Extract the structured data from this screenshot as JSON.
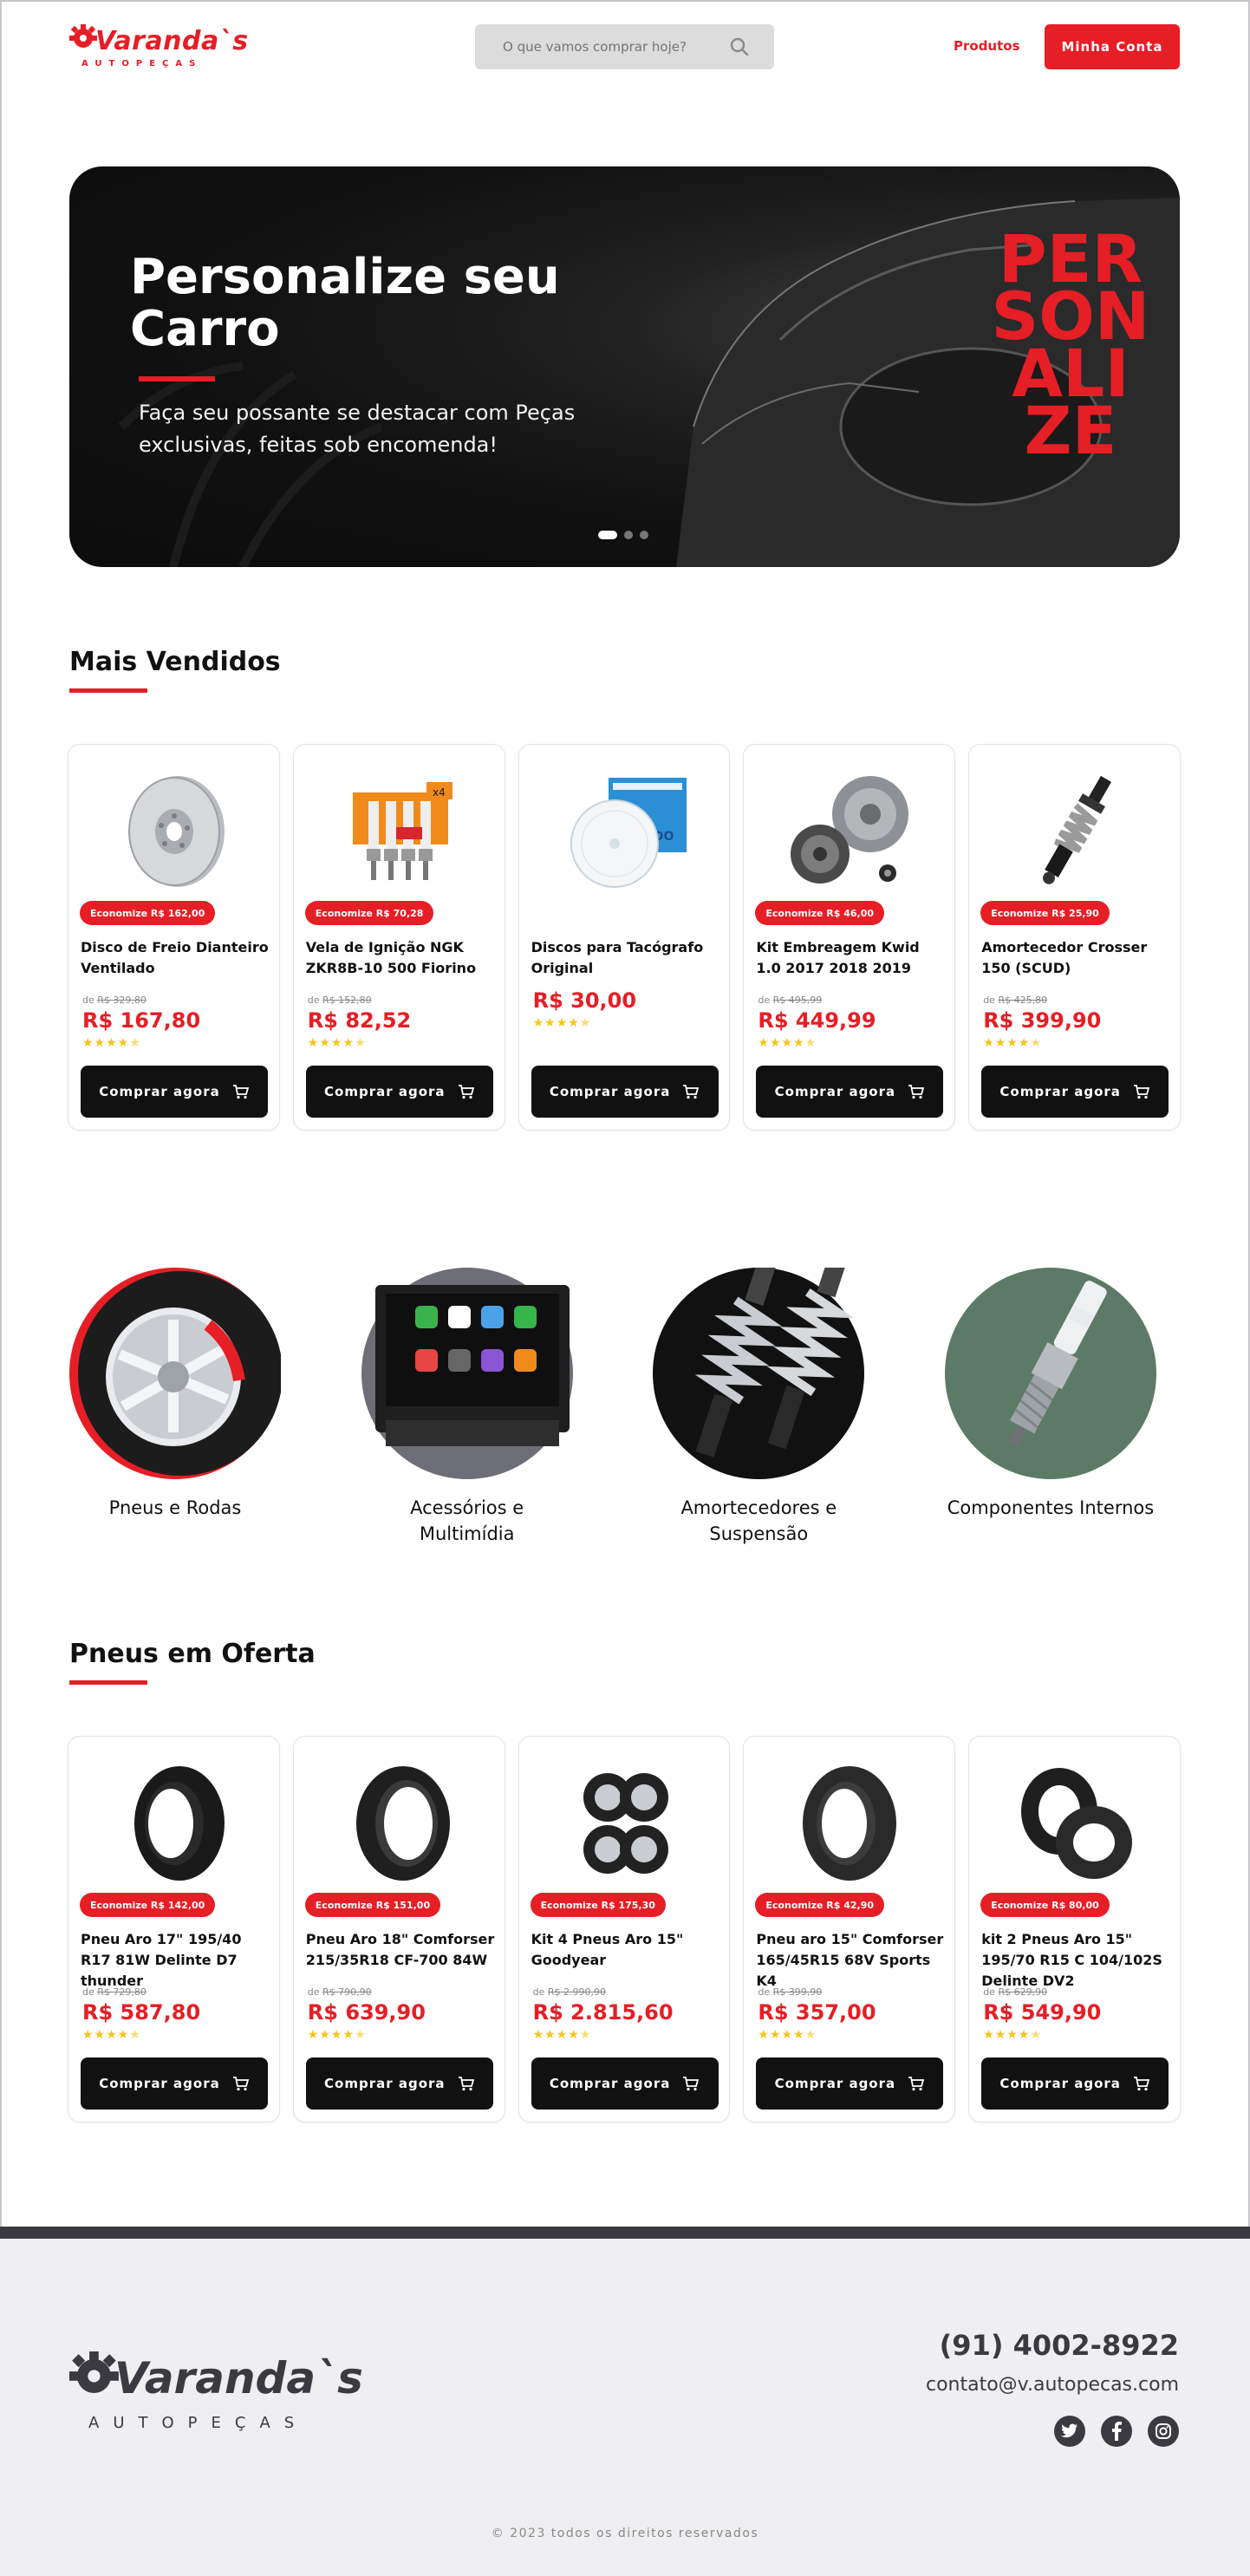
{
  "header": {
    "logo_name": "Varanda`s",
    "logo_sub": "AUTOPEÇAS",
    "search_placeholder": "O que vamos comprar hoje?",
    "nav_products": "Produtos",
    "account_button": "Minha Conta"
  },
  "hero": {
    "title": "Personalize seu Carro",
    "subtitle": "Faça seu possante se destacar com Peças exclusivas, feitas sob encomenda!",
    "vertical_text": "PERSONALIZE",
    "slides_total": 3,
    "active_slide": 1
  },
  "best_sellers": {
    "title": "Mais Vendidos",
    "products": [
      {
        "badge": "Economize R$ 162,00",
        "name": "Disco de Freio Dianteiro Ventilado",
        "old_price": "R$ 329,80",
        "price": "R$ 167,80",
        "rating": 4.5,
        "button": "Comprar agora",
        "icon": "brake-disc-icon"
      },
      {
        "badge": "Economize R$ 70,28",
        "name": "Vela de Ignição NGK ZKR8B-10 500 Fiorino",
        "old_price": "R$ 152,80",
        "price": "R$ 82,52",
        "rating": 4.5,
        "button": "Comprar agora",
        "icon": "spark-plug-icon"
      },
      {
        "badge": "",
        "name": "Discos para Tacógrafo Original",
        "old_price": "",
        "price": "R$ 30,00",
        "rating": 4.5,
        "button": "Comprar agora",
        "icon": "tachograph-disc-icon"
      },
      {
        "badge": "Economize R$ 46,00",
        "name": "Kit Embreagem Kwid 1.0 2017 2018 2019",
        "old_price": "R$ 495,99",
        "price": "R$ 449,99",
        "rating": 4.5,
        "button": "Comprar agora",
        "icon": "clutch-kit-icon"
      },
      {
        "badge": "Economize R$ 25,90",
        "name": "Amortecedor Crosser 150 (SCUD)",
        "old_price": "R$ 425,80",
        "price": "R$ 399,90",
        "rating": 4.5,
        "button": "Comprar agora",
        "icon": "shock-absorber-icon"
      }
    ]
  },
  "old_price_prefix": "de",
  "categories": [
    {
      "label": "Pneus e Rodas",
      "icon": "tire-icon",
      "color": "#e61e25"
    },
    {
      "label": "Acessórios e Multimídia",
      "icon": "multimedia-icon",
      "color": "#6e6e78"
    },
    {
      "label": "Amortecedores e Suspensão",
      "icon": "suspension-icon",
      "color": "#111111"
    },
    {
      "label": "Componentes Internos",
      "icon": "spark-plug-icon",
      "color": "#5c7a66"
    }
  ],
  "tires_offer": {
    "title": "Pneus em Oferta",
    "products": [
      {
        "badge": "Economize R$ 142,00",
        "name": "Pneu Aro 17\" 195/40 R17 81W Delinte D7 thunder",
        "old_price": "R$ 729,80",
        "price": "R$ 587,80",
        "rating": 4.5,
        "button": "Comprar agora",
        "icon": "tire-icon"
      },
      {
        "badge": "Economize R$ 151,00",
        "name": "Pneu Aro 18\" Comforser 215/35R18 CF-700 84W",
        "old_price": "R$ 790,90",
        "price": "R$ 639,90",
        "rating": 4.5,
        "button": "Comprar agora",
        "icon": "tire-icon"
      },
      {
        "badge": "Economize R$ 175,30",
        "name": "Kit 4 Pneus Aro 15\" Goodyear",
        "old_price": "R$ 2.990,90",
        "price": "R$ 2.815,60",
        "rating": 4.5,
        "button": "Comprar agora",
        "icon": "tire-set-icon"
      },
      {
        "badge": "Economize R$ 42,90",
        "name": "Pneu aro 15\" Comforser 165/45R15 68V Sports K4",
        "old_price": "R$ 399,90",
        "price": "R$ 357,00",
        "rating": 4.5,
        "button": "Comprar agora",
        "icon": "tire-icon"
      },
      {
        "badge": "Economize R$ 80,00",
        "name": "kit 2 Pneus Aro 15\" 195/70 R15 C 104/102S Delinte DV2",
        "old_price": "R$ 629,90",
        "price": "R$ 549,90",
        "rating": 4.5,
        "button": "Comprar agora",
        "icon": "tire-pair-icon"
      }
    ]
  },
  "footer": {
    "logo_name": "Varanda`s",
    "logo_sub": "AUTOPEÇAS",
    "phone": "(91) 4002-8922",
    "email": "contato@v.autopecas.com",
    "socials": [
      "twitter-icon",
      "facebook-icon",
      "instagram-icon"
    ],
    "copyright": "© 2023 todos os direitos reservados"
  },
  "colors": {
    "accent": "#e61e25",
    "dark": "#111111",
    "footer_text": "#3a3a40",
    "footer_bg": "#efeff1",
    "stars": "#f5c518"
  }
}
